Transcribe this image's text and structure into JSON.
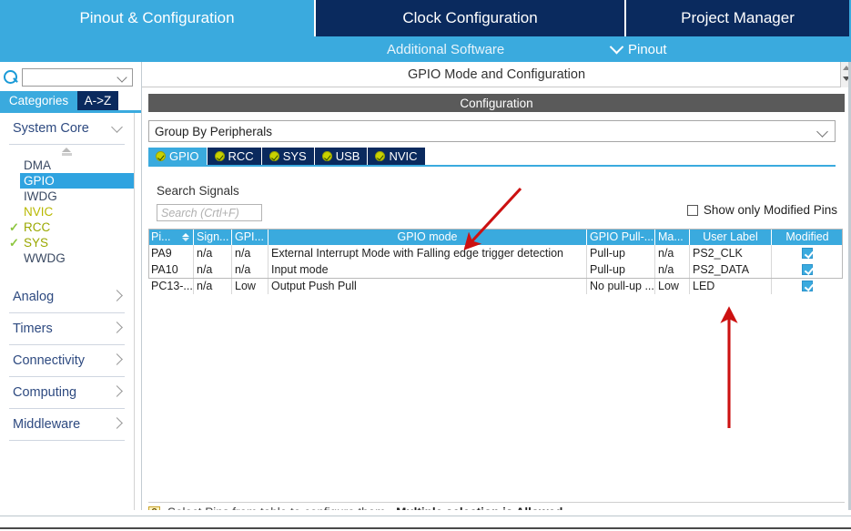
{
  "top_tabs": [
    {
      "label": "Pinout & Configuration",
      "active": true
    },
    {
      "label": "Clock Configuration",
      "active": false
    },
    {
      "label": "Project Manager",
      "active": false
    }
  ],
  "sub_bar": {
    "additional_software": "Additional Software",
    "pinout_menu": "Pinout",
    "chevron_icon": "chevron-down-icon"
  },
  "sidebar": {
    "search_value": "",
    "search_icon": "search-icon",
    "tabs": [
      {
        "label": "Categories",
        "selected": true
      },
      {
        "label": "A->Z",
        "selected": false
      }
    ],
    "groups": [
      {
        "label": "System Core",
        "expanded": true
      },
      {
        "label": "Analog",
        "expanded": false
      },
      {
        "label": "Timers",
        "expanded": false
      },
      {
        "label": "Connectivity",
        "expanded": false
      },
      {
        "label": "Computing",
        "expanded": false
      },
      {
        "label": "Middleware",
        "expanded": false
      }
    ],
    "peripherals": [
      {
        "label": "DMA",
        "state": "none",
        "selected": false
      },
      {
        "label": "GPIO",
        "state": "none",
        "selected": true
      },
      {
        "label": "IWDG",
        "state": "none",
        "selected": false
      },
      {
        "label": "NVIC",
        "state": "warn",
        "selected": false
      },
      {
        "label": "RCC",
        "state": "check",
        "selected": false
      },
      {
        "label": "SYS",
        "state": "check",
        "selected": false
      },
      {
        "label": "WWDG",
        "state": "none",
        "selected": false
      }
    ]
  },
  "main": {
    "title": "GPIO Mode and Configuration",
    "configuration_bar": "Configuration",
    "group_select_value": "Group By Peripherals",
    "peripheral_tabs": [
      {
        "label": "GPIO",
        "active": true,
        "icon": "check-circle-icon"
      },
      {
        "label": "RCC",
        "active": false,
        "icon": "check-circle-icon"
      },
      {
        "label": "SYS",
        "active": false,
        "icon": "check-circle-icon"
      },
      {
        "label": "USB",
        "active": false,
        "icon": "check-circle-icon"
      },
      {
        "label": "NVIC",
        "active": false,
        "icon": "check-circle-icon"
      }
    ],
    "search_signals_label": "Search Signals",
    "search_placeholder": "Search (Crtl+F)",
    "show_only_modified": "Show only Modified Pins",
    "show_only_modified_checked": false,
    "table": {
      "columns": [
        {
          "label": "Pi...",
          "key": "pin",
          "sortable": true
        },
        {
          "label": "Sign...",
          "key": "signal"
        },
        {
          "label": "GPI...",
          "key": "output"
        },
        {
          "label": "GPIO mode",
          "key": "mode"
        },
        {
          "label": "GPIO Pull-...",
          "key": "pull"
        },
        {
          "label": "Ma...",
          "key": "maxspeed"
        },
        {
          "label": "User Label",
          "key": "user"
        },
        {
          "label": "Modified",
          "key": "modified"
        }
      ],
      "rows": [
        {
          "pin": "PA9",
          "signal": "n/a",
          "output": "n/a",
          "mode": "External Interrupt Mode with Falling edge trigger detection",
          "pull": "Pull-up",
          "maxspeed": "n/a",
          "user": "PS2_CLK",
          "modified": true
        },
        {
          "pin": "PA10",
          "signal": "n/a",
          "output": "n/a",
          "mode": "Input mode",
          "pull": "Pull-up",
          "maxspeed": "n/a",
          "user": "PS2_DATA",
          "modified": true
        },
        {
          "pin": "PC13-...",
          "signal": "n/a",
          "output": "Low",
          "mode": "Output Push Pull",
          "pull": "No pull-up ...",
          "maxspeed": "Low",
          "user": "LED",
          "modified": true
        }
      ]
    },
    "hint_icon": "question-icon",
    "hint_text": "Select Pins from table to configure them.",
    "hint_bold": "Multiple selection is Allowed."
  },
  "annotations": [
    {
      "name": "arrow-to-gpio-mode-header",
      "color": "#cc1111"
    },
    {
      "name": "arrow-to-user-label-led",
      "color": "#cc1111"
    }
  ],
  "colors": {
    "accent_blue": "#3aaade",
    "dark_navy": "#0a2a5e",
    "header_gray": "#5a5a5a",
    "annotation_red": "#cc1111",
    "check_green": "#8dc63f"
  }
}
